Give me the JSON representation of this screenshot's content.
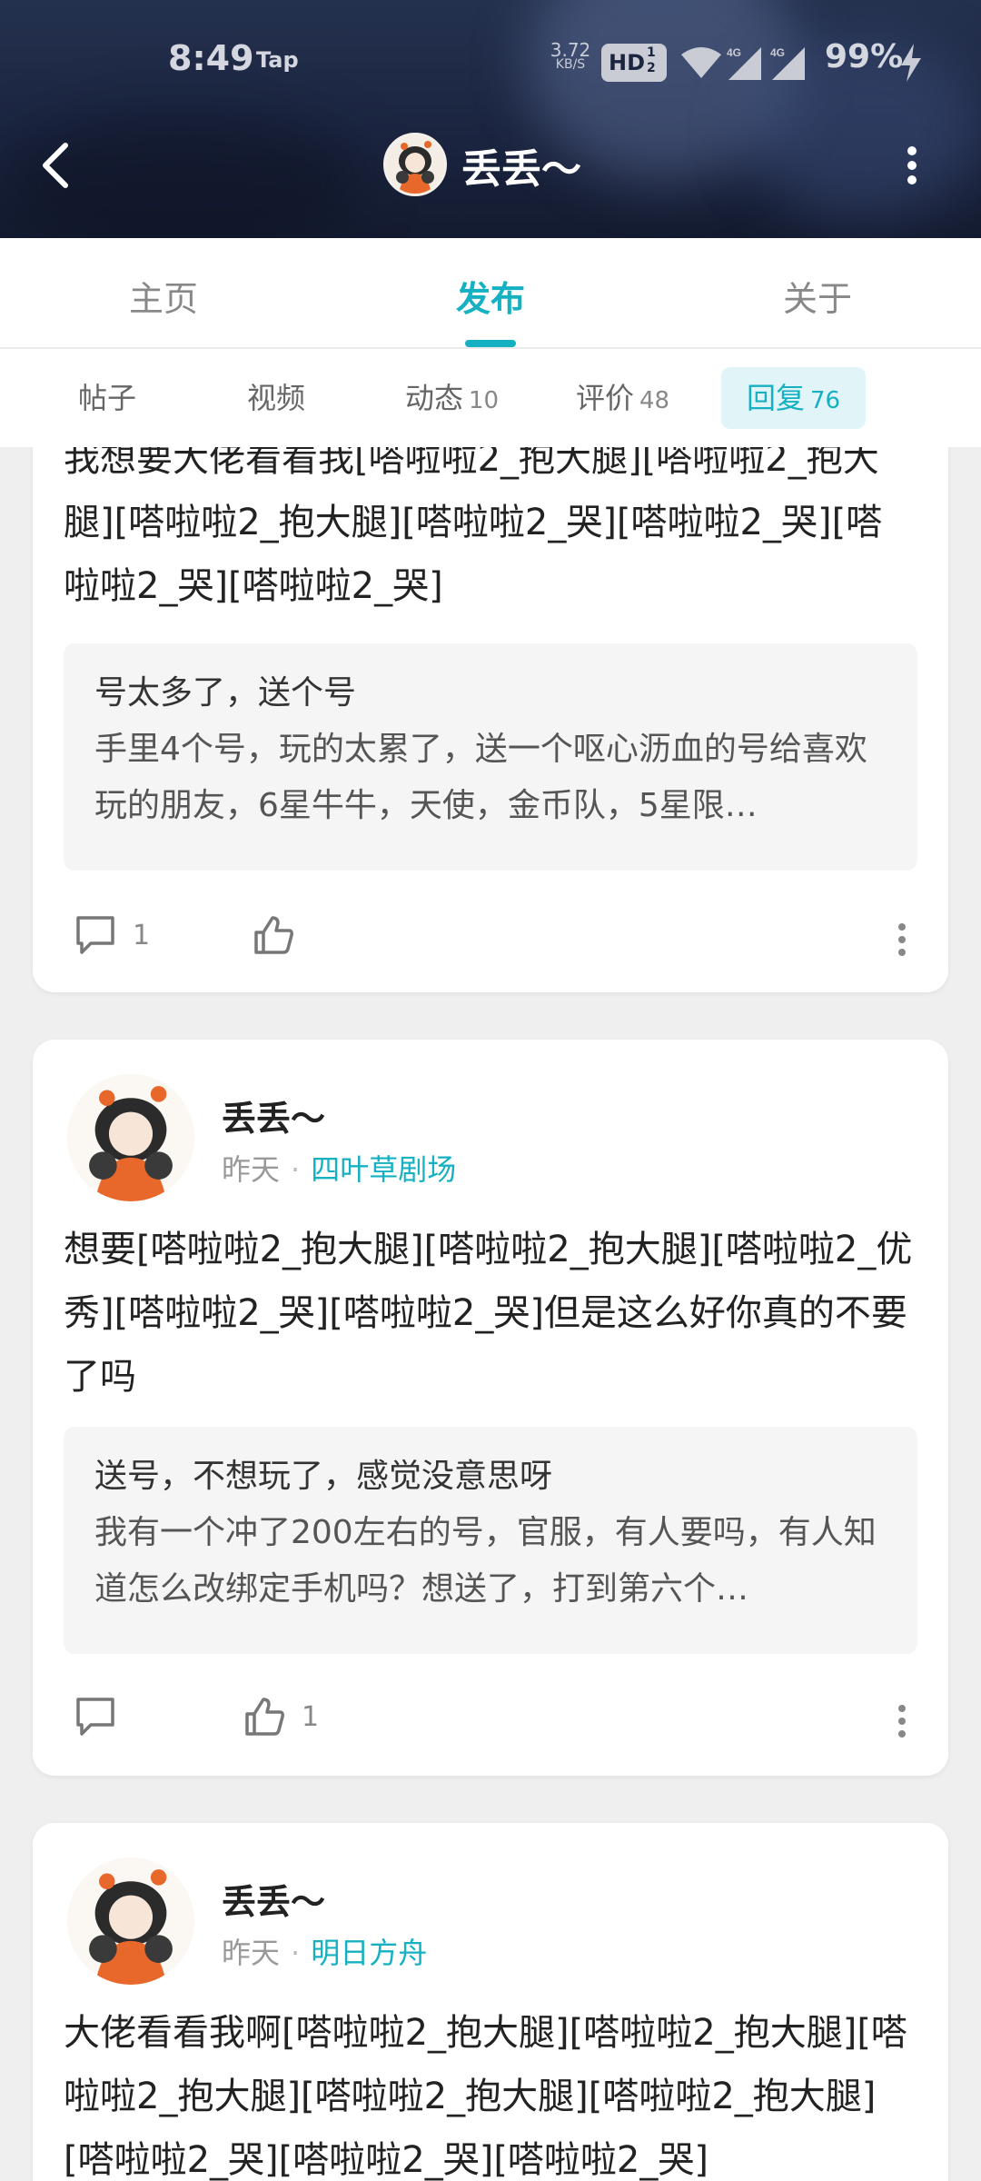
{
  "status_bar": {
    "time": "8:49",
    "app_tag": "Tap",
    "net_speed": "3.72",
    "net_speed_unit": "KB/S",
    "hd_label": "HD",
    "hd_frac_top": "1",
    "hd_frac_bottom": "2",
    "signal1_label": "4G",
    "signal2_label": "4G",
    "battery": "99%"
  },
  "header": {
    "user_name": "丢丢〜"
  },
  "main_tabs": [
    {
      "label": "主页"
    },
    {
      "label": "发布"
    },
    {
      "label": "关于"
    }
  ],
  "main_tab_active": "发布",
  "sub_tabs": [
    {
      "label": "帖子",
      "count": ""
    },
    {
      "label": "视频",
      "count": ""
    },
    {
      "label": "动态",
      "count": "10"
    },
    {
      "label": "评价",
      "count": "48"
    },
    {
      "label": "回复",
      "count": "76"
    }
  ],
  "sub_tab_active": "回复",
  "colors": {
    "accent": "#15b0c1",
    "header_bg": "#1b2540",
    "quote_bg": "#f5f5f5"
  },
  "posts": [
    {
      "body": "我想要大佬看看我[嗒啦啦2_抱大腿][嗒啦啦2_抱大腿][嗒啦啦2_抱大腿][嗒啦啦2_哭][嗒啦啦2_哭][嗒啦啦2_哭][嗒啦啦2_哭]",
      "quote_title": "号太多了，送个号",
      "quote_text": "手里4个号，玩的太累了，送一个呕心沥血的号给喜欢玩的朋友，6星牛牛，天使，金币队，5星限…",
      "comment_count": "1",
      "like_count": ""
    },
    {
      "author": "丢丢〜",
      "time": "昨天",
      "forum": "四叶草剧场",
      "body": "想要[嗒啦啦2_抱大腿][嗒啦啦2_抱大腿][嗒啦啦2_优秀][嗒啦啦2_哭][嗒啦啦2_哭]但是这么好你真的不要了吗",
      "quote_title": "送号，不想玩了，感觉没意思呀",
      "quote_text": "我有一个冲了200左右的号，官服，有人要吗，有人知道怎么改绑定手机吗？想送了，打到第六个…",
      "comment_count": "",
      "like_count": "1"
    },
    {
      "author": "丢丢〜",
      "time": "昨天",
      "forum": "明日方舟",
      "body": "大佬看看我啊[嗒啦啦2_抱大腿][嗒啦啦2_抱大腿][嗒啦啦2_抱大腿][嗒啦啦2_抱大腿][嗒啦啦2_抱大腿][嗒啦啦2_哭][嗒啦啦2_哭][嗒啦啦2_哭]"
    }
  ]
}
